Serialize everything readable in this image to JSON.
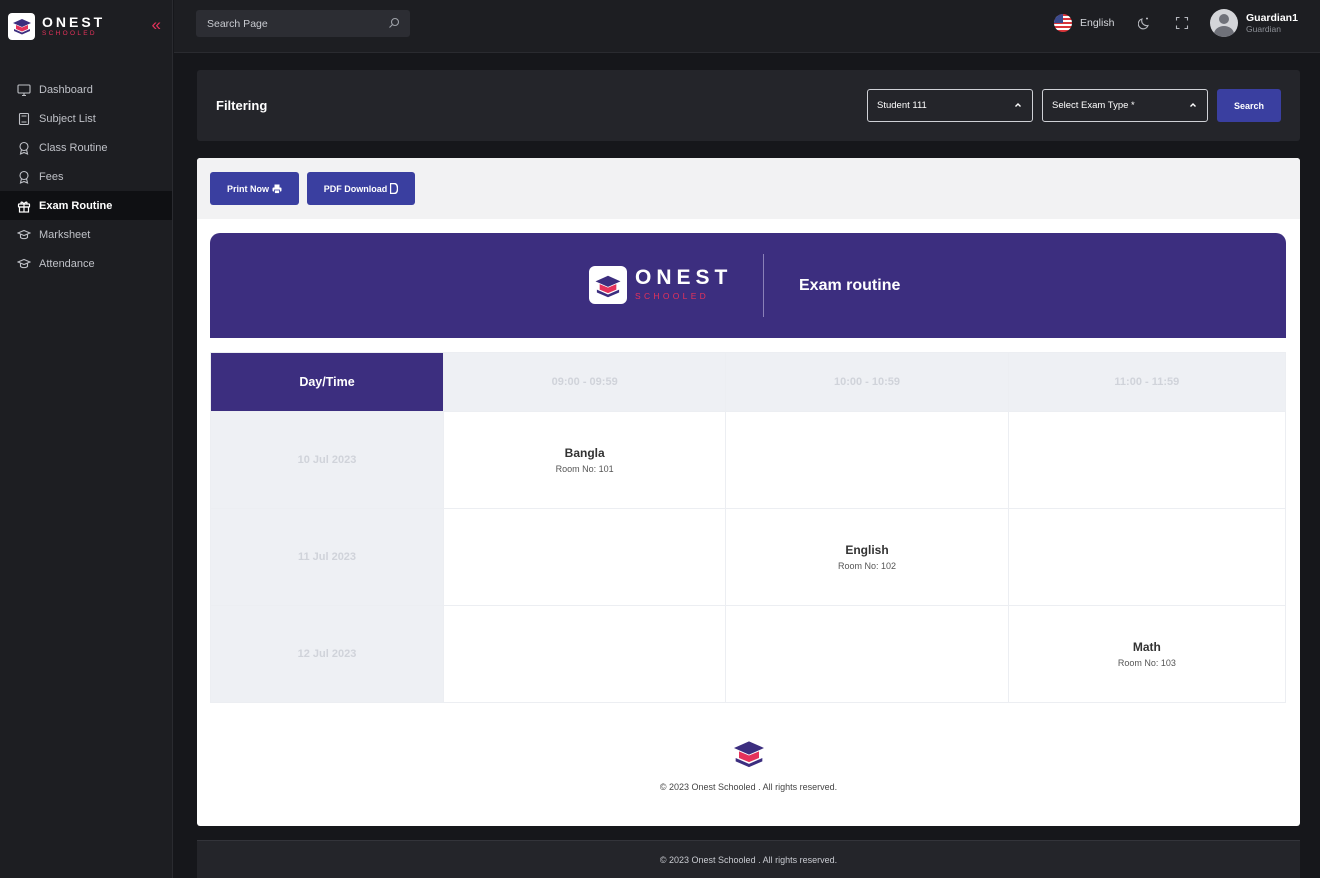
{
  "brand": {
    "name": "ONEST",
    "tagline": "SCHOOLED"
  },
  "sidebar": {
    "items": [
      {
        "label": "Dashboard",
        "icon": "monitor-icon"
      },
      {
        "label": "Subject List",
        "icon": "book-icon"
      },
      {
        "label": "Class Routine",
        "icon": "award-icon"
      },
      {
        "label": "Fees",
        "icon": "award-icon"
      },
      {
        "label": "Exam Routine",
        "icon": "gift-icon",
        "active": true
      },
      {
        "label": "Marksheet",
        "icon": "graduation-cap-icon"
      },
      {
        "label": "Attendance",
        "icon": "graduation-cap-icon"
      }
    ]
  },
  "topbar": {
    "search_placeholder": "Search Page",
    "language": "English",
    "user_name": "Guardian1",
    "user_role": "Guardian"
  },
  "filter": {
    "title": "Filtering",
    "student_select": "Student 111",
    "exam_type_select": "Select Exam Type *",
    "search_label": "Search"
  },
  "actions": {
    "print_label": "Print Now",
    "pdf_label": "PDF Download"
  },
  "routine": {
    "title": "Exam routine",
    "header_label": "Day/Time",
    "time_slots": [
      "09:00 - 09:59",
      "10:00 - 10:59",
      "11:00 - 11:59"
    ],
    "days": [
      {
        "date": "10 Jul 2023",
        "cells": [
          {
            "subject": "Bangla",
            "room": "Room No: 101"
          },
          null,
          null
        ]
      },
      {
        "date": "11 Jul 2023",
        "cells": [
          null,
          {
            "subject": "English",
            "room": "Room No: 102"
          },
          null
        ]
      },
      {
        "date": "12 Jul 2023",
        "cells": [
          null,
          null,
          {
            "subject": "Math",
            "room": "Room No: 103"
          }
        ]
      }
    ]
  },
  "footer": {
    "card_copyright": "© 2023 Onest Schooled . All rights reserved.",
    "page_copyright": "© 2023 Onest Schooled . All rights reserved."
  },
  "colors": {
    "accent": "#3a3fa0",
    "banner": "#3c2e7f",
    "brand_pink": "#e5325b",
    "sidebar_bg": "#1d1e22"
  }
}
